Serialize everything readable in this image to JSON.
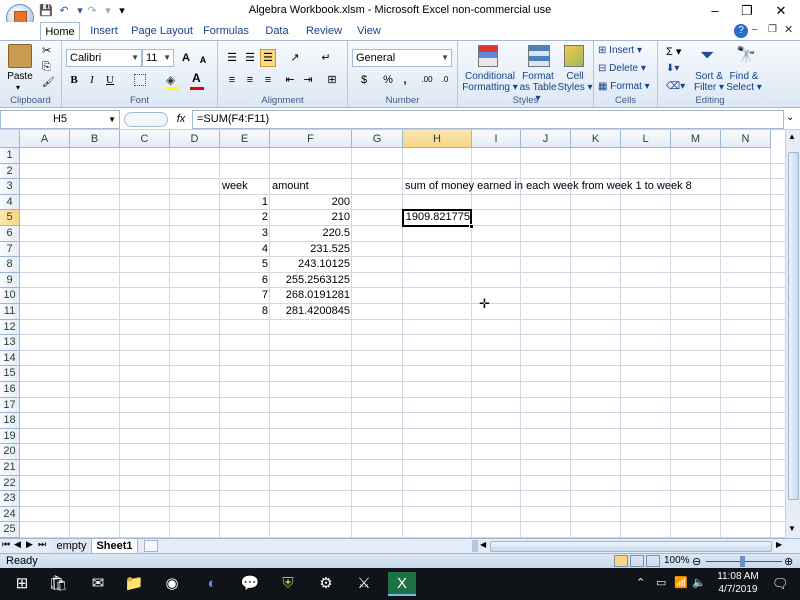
{
  "window": {
    "title": "Algebra Workbook.xlsm - Microsoft Excel non-commercial use",
    "controls": {
      "minimize": "–",
      "restore": "❐",
      "close": "✕"
    }
  },
  "qat": {
    "save": "💾",
    "undo": "↶",
    "redo": "↷",
    "customize": "▾"
  },
  "ribbon_tabs": [
    "Home",
    "Insert",
    "Page Layout",
    "Formulas",
    "Data",
    "Review",
    "View"
  ],
  "ribbon": {
    "clipboard": {
      "label": "Clipboard",
      "paste": "Paste",
      "cut": "✂",
      "copy": "⎘",
      "painter": "🖌"
    },
    "font": {
      "label": "Font",
      "name": "Calibri",
      "size": "11",
      "grow": "A",
      "shrink": "A",
      "bold": "B",
      "italic": "I",
      "underline": "U"
    },
    "alignment": {
      "label": "Alignment"
    },
    "number": {
      "label": "Number",
      "format": "General",
      "currency": "$",
      "percent": "%",
      "comma": ",",
      "inc_dec": ".00",
      "dec_dec": ".0"
    },
    "styles": {
      "label": "Styles",
      "conditional": "Conditional",
      "conditional2": "Formatting ▾",
      "format_table": "Format",
      "format_table2": "as Table ▾",
      "cell_styles": "Cell",
      "cell_styles2": "Styles ▾"
    },
    "cells": {
      "label": "Cells",
      "insert": "Insert ▾",
      "delete": "Delete ▾",
      "format": "Format ▾"
    },
    "editing": {
      "label": "Editing",
      "sum": "Σ ▾",
      "fill": "▾",
      "clear": "▾",
      "sort": "Sort &",
      "sort2": "Filter ▾",
      "find": "Find &",
      "find2": "Select ▾"
    }
  },
  "formula_bar": {
    "name_box": "H5",
    "fx": "fx",
    "formula": "=SUM(F4:F11)"
  },
  "columns": [
    "A",
    "B",
    "C",
    "D",
    "E",
    "F",
    "G",
    "H",
    "I",
    "J",
    "K",
    "L",
    "M",
    "N"
  ],
  "rows": [
    "1",
    "2",
    "3",
    "4",
    "5",
    "6",
    "7",
    "8",
    "9",
    "10",
    "11",
    "12",
    "13",
    "14",
    "15",
    "16",
    "17",
    "18",
    "19",
    "20",
    "21",
    "22",
    "23",
    "24",
    "25"
  ],
  "cells": {
    "E3": "week",
    "F3": "amount",
    "H3": "sum of money earned in each week from week 1 to week 8",
    "E4": "1",
    "F4": "200",
    "E5": "2",
    "F5": "210",
    "E6": "3",
    "F6": "220.5",
    "E7": "4",
    "F7": "231.525",
    "E8": "5",
    "F8": "243.10125",
    "E9": "6",
    "F9": "255.2563125",
    "E10": "7",
    "F10": "268.0191281",
    "E11": "8",
    "F11": "281.4200845",
    "H5": "1909.821775"
  },
  "selected_cell": "H5",
  "sheet_tabs": [
    "empty",
    "Sheet1"
  ],
  "active_sheet": "Sheet1",
  "status": {
    "mode": "Ready",
    "zoom": "100%"
  },
  "taskbar": {
    "time": "11:08 AM",
    "date": "4/7/2019"
  }
}
